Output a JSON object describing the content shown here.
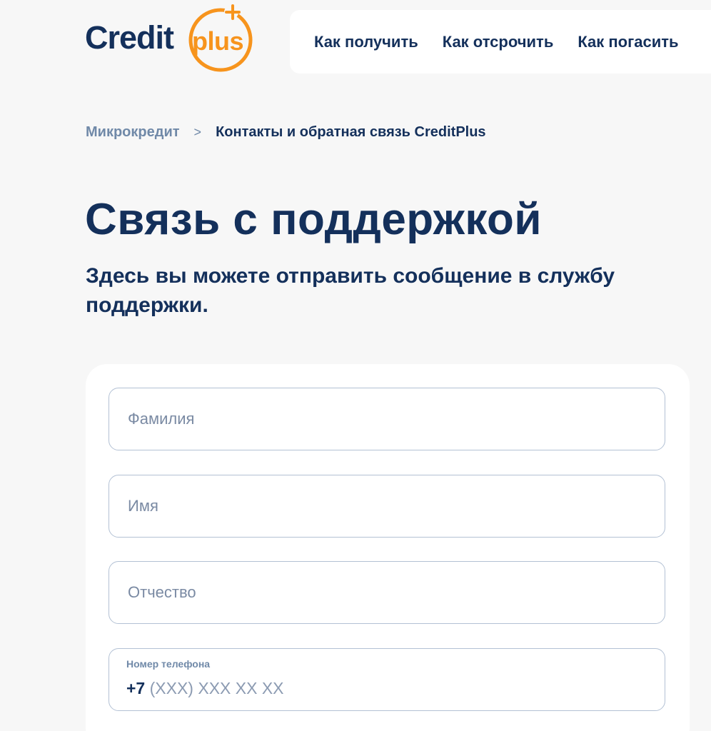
{
  "logo": {
    "word": "Credit",
    "plus": "plus",
    "brand_color": "#14305b",
    "accent_color": "#f7941d"
  },
  "nav": {
    "items": [
      {
        "label": "Как получить"
      },
      {
        "label": "Как отсрочить"
      },
      {
        "label": "Как погасить"
      }
    ]
  },
  "breadcrumb": {
    "parent": "Микрокредит",
    "separator": ">",
    "current": "Контакты и обратная связь CreditPlus"
  },
  "page": {
    "title": "Связь с поддержкой",
    "subtitle": "Здесь вы можете отправить сообщение в службу поддержки."
  },
  "form": {
    "surname": {
      "placeholder": "Фамилия",
      "value": ""
    },
    "name": {
      "placeholder": "Имя",
      "value": ""
    },
    "patronymic": {
      "placeholder": "Отчество",
      "value": ""
    },
    "phone": {
      "label": "Номер телефона",
      "prefix": "+7",
      "mask": "(XXX) XXX XX XX"
    }
  }
}
